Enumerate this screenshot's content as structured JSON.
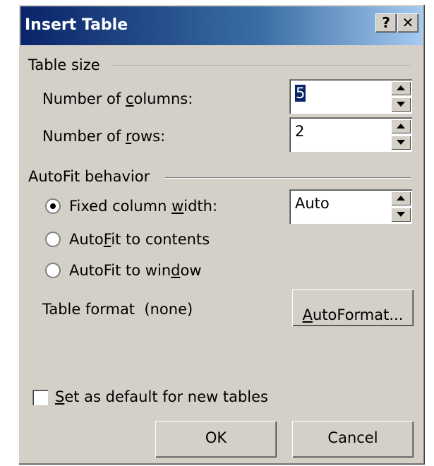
{
  "dialog": {
    "title": "Insert Table",
    "help_glyph": "?",
    "close_glyph": "✕"
  },
  "table_size": {
    "group_label": "Table size",
    "columns": {
      "label_pre": "Number of ",
      "label_u": "c",
      "label_post": "olumns:",
      "value": "5"
    },
    "rows": {
      "label_pre": "Number of ",
      "label_u": "r",
      "label_post": "ows:",
      "value": "2"
    }
  },
  "autofit": {
    "group_label": "AutoFit behavior",
    "options": [
      {
        "pre": "Fixed column ",
        "u": "w",
        "post": "idth:",
        "checked": true
      },
      {
        "pre": "Auto",
        "u": "F",
        "post": "it to contents",
        "checked": false
      },
      {
        "pre": "AutoFit to win",
        "u": "d",
        "post": "ow",
        "checked": false
      }
    ],
    "fixed_width_value": "Auto"
  },
  "table_format": {
    "label": "Table format",
    "value": "(none)",
    "autoformat_u": "A",
    "autoformat_post": "utoFormat..."
  },
  "default_checkbox": {
    "u": "S",
    "post": "et as default for new tables",
    "checked": false
  },
  "buttons": {
    "ok": "OK",
    "cancel": "Cancel"
  }
}
